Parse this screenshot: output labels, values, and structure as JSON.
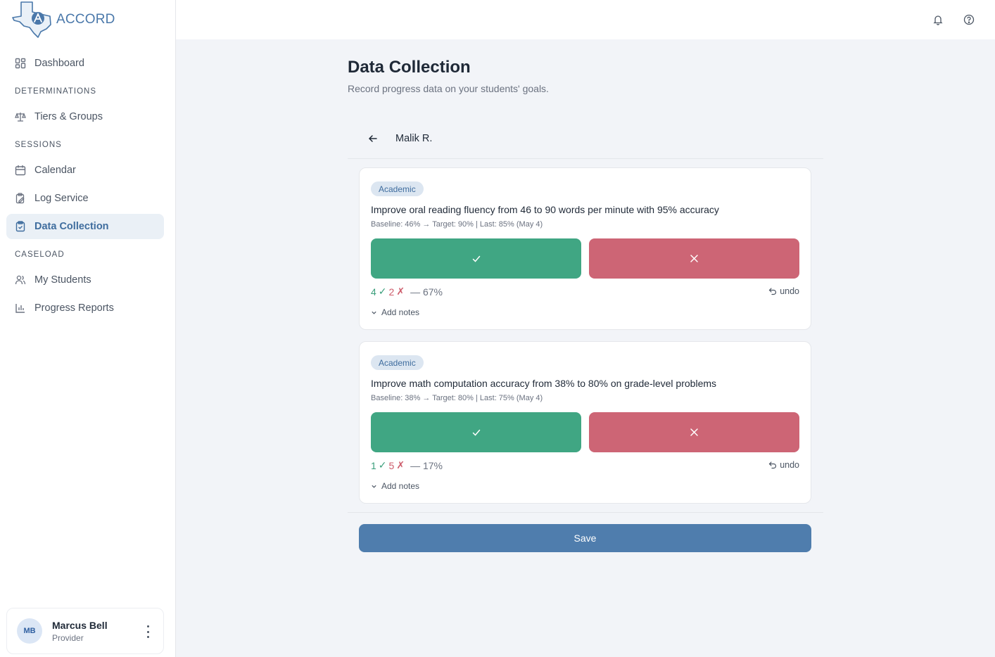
{
  "brand": {
    "name": "ACCORD"
  },
  "sidebar": {
    "dashboard": "Dashboard",
    "sections": {
      "determinations": "DETERMINATIONS",
      "sessions": "SESSIONS",
      "caseload": "CASELOAD"
    },
    "items": {
      "tiers_groups": "Tiers & Groups",
      "calendar": "Calendar",
      "log_service": "Log Service",
      "data_collection": "Data Collection",
      "my_students": "My Students",
      "progress_reports": "Progress Reports"
    },
    "active": "Data Collection"
  },
  "user": {
    "initials": "MB",
    "name": "Marcus Bell",
    "role": "Provider"
  },
  "page": {
    "title": "Data Collection",
    "subtitle": "Record progress data on your students' goals."
  },
  "student": {
    "name": "Malik R."
  },
  "goals": [
    {
      "category": "Academic",
      "text": "Improve oral reading fluency from 46 to 90 words per minute with 95% accuracy",
      "meta": "Baseline: 46% → Target: 90% | Last: 85% (May 4)",
      "correct": "4",
      "incorrect": "2",
      "percent": "— 67%"
    },
    {
      "category": "Academic",
      "text": "Improve math computation accuracy from 38% to 80% on grade-level problems",
      "meta": "Baseline: 38% → Target: 80% | Last: 75% (May 4)",
      "correct": "1",
      "incorrect": "5",
      "percent": "— 17%"
    }
  ],
  "labels": {
    "undo": "undo",
    "add_notes": "Add notes",
    "check": "✓",
    "cross": "✗",
    "save": "Save"
  },
  "colors": {
    "accent": "#4f7dad",
    "success": "#40a683",
    "danger": "#cd6575"
  }
}
